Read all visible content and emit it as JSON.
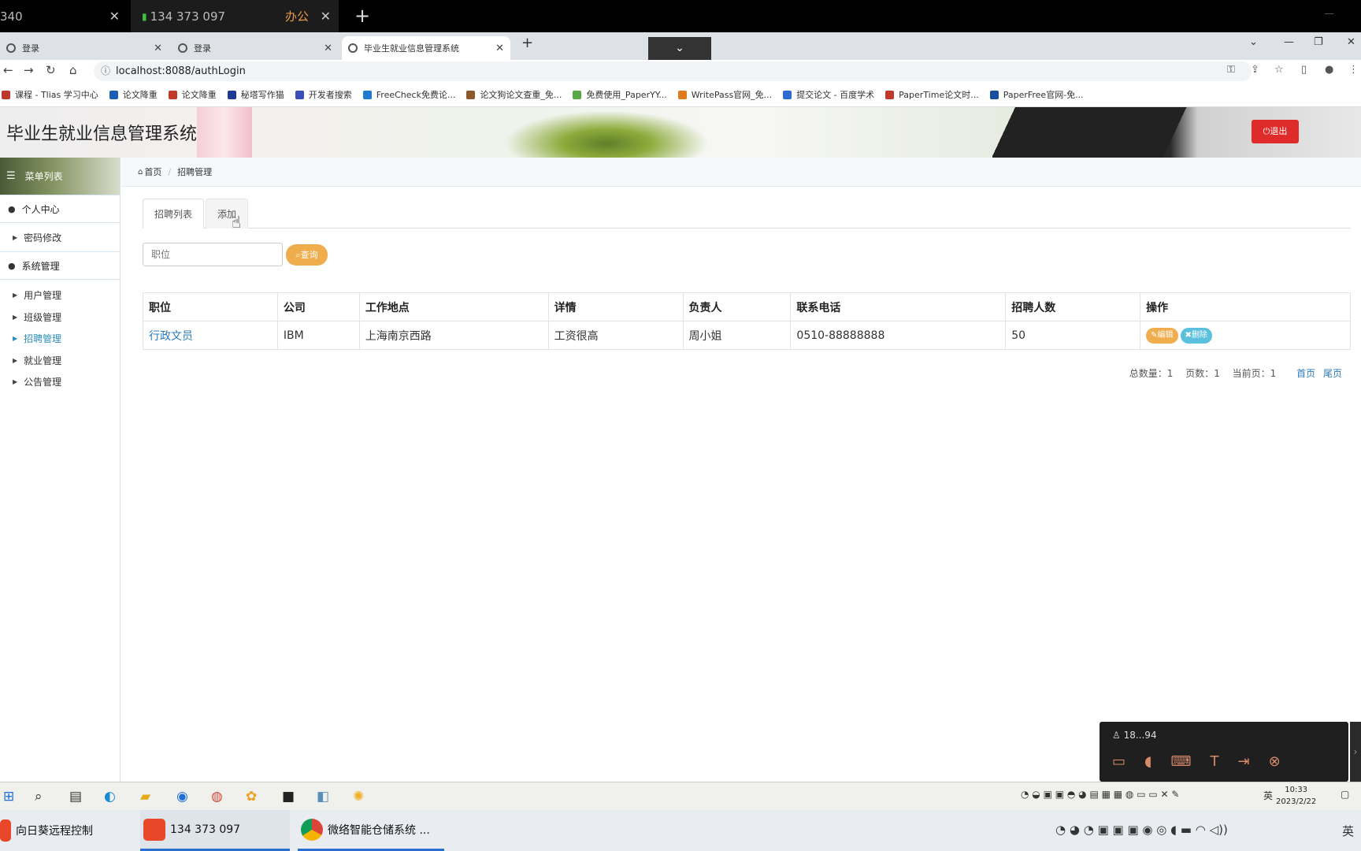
{
  "remote_tabs": [
    {
      "label": "340"
    },
    {
      "label": "134 373 097",
      "tag": "办公"
    }
  ],
  "browser_tabs": [
    {
      "label": "登录"
    },
    {
      "label": "登录"
    },
    {
      "label": "毕业生就业信息管理系统"
    }
  ],
  "address": {
    "url": "localhost:8088/authLogin"
  },
  "bookmarks": [
    {
      "label": "课程 - Tlias 学习中心",
      "color": "#c0392b"
    },
    {
      "label": "论文降重",
      "color": "#1a5fb4"
    },
    {
      "label": "论文降重",
      "color": "#c0392b"
    },
    {
      "label": "秘塔写作猫",
      "color": "#1f3a93"
    },
    {
      "label": "开发者搜索",
      "color": "#3b4db8"
    },
    {
      "label": "FreeCheck免费论...",
      "color": "#1f7ad0"
    },
    {
      "label": "论文狗论文查重_免...",
      "color": "#8a5a2b"
    },
    {
      "label": "免费使用_PaperYY...",
      "color": "#5aa845"
    },
    {
      "label": "WritePass官网_免...",
      "color": "#e07b1d"
    },
    {
      "label": "提交论文 - 百度学术",
      "color": "#2d6bd3"
    },
    {
      "label": "PaperTime论文时...",
      "color": "#c0392b"
    },
    {
      "label": "PaperFree官网-免...",
      "color": "#1a4fa0"
    }
  ],
  "app": {
    "title": "毕业生就业信息管理系统",
    "logout": "退出"
  },
  "sidebar": {
    "heading": "菜单列表",
    "groups": [
      {
        "label": "个人中心",
        "items": [
          "密码修改"
        ]
      },
      {
        "label": "系统管理",
        "items": [
          "用户管理",
          "班级管理",
          "招聘管理",
          "就业管理",
          "公告管理"
        ]
      }
    ],
    "active": "招聘管理"
  },
  "breadcrumb": {
    "home": "首页",
    "current": "招聘管理"
  },
  "tabs": {
    "list": "招聘列表",
    "add": "添加"
  },
  "search": {
    "placeholder": "职位",
    "button": "查询"
  },
  "table": {
    "headers": [
      "职位",
      "公司",
      "工作地点",
      "详情",
      "负责人",
      "联系电话",
      "招聘人数",
      "操作"
    ],
    "rows": [
      {
        "job": "行政文员",
        "company": "IBM",
        "location": "上海南京西路",
        "detail": "工资很高",
        "contact": "周小姐",
        "phone": "0510-88888888",
        "count": "50",
        "edit": "编辑",
        "delete": "删除"
      }
    ]
  },
  "pager": {
    "total": "总数量：1",
    "pages": "页数：1",
    "current": "当前页：1",
    "first": "首页",
    "last": "尾页"
  },
  "remote_panel": {
    "user": "18...94"
  },
  "inner_taskbar": {
    "ime": "英",
    "time": "10:33",
    "date": "2023/2/22"
  },
  "host_taskbar": {
    "tasks": [
      "向日葵远程控制",
      "134 373 097",
      "微络智能仓储系统 ..."
    ],
    "ime": "英"
  }
}
